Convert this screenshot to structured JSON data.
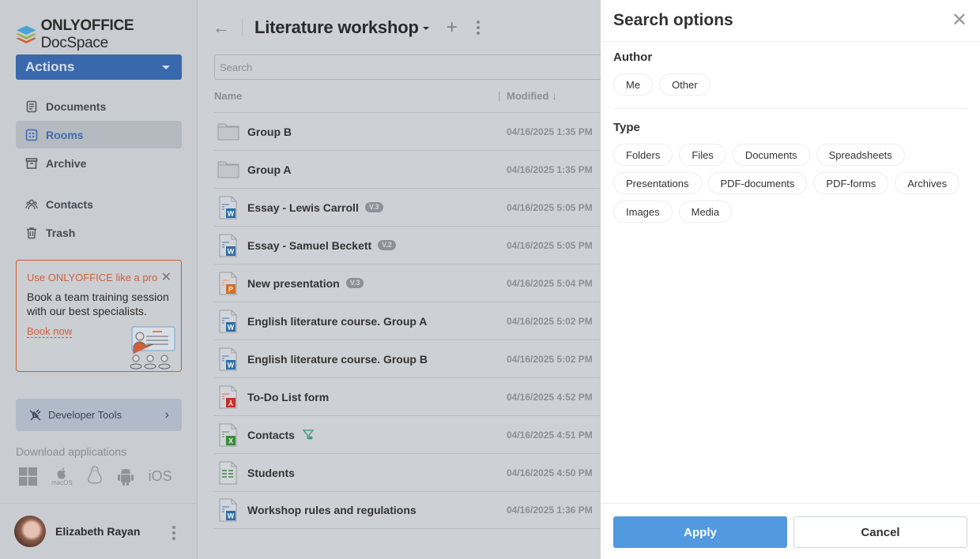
{
  "app": {
    "logo_bold": "ONLYOFFICE",
    "logo_light": "DocSpace"
  },
  "sidebar": {
    "actions_label": "Actions",
    "nav_primary": [
      {
        "label": "Documents",
        "icon": "document-icon",
        "active": false
      },
      {
        "label": "Rooms",
        "icon": "rooms-icon",
        "active": true
      },
      {
        "label": "Archive",
        "icon": "archive-icon",
        "active": false
      }
    ],
    "nav_secondary": [
      {
        "label": "Contacts",
        "icon": "contacts-icon"
      },
      {
        "label": "Trash",
        "icon": "trash-icon"
      }
    ],
    "promo": {
      "title": "Use ONLYOFFICE like a pro",
      "body": "Book a team training session with our best specialists.",
      "link": "Book now"
    },
    "developer_tools_label": "Developer Tools",
    "download_title": "Download applications",
    "download_apps": [
      "windows-icon",
      "macos-icon",
      "linux-icon",
      "android-icon",
      "ios-icon"
    ],
    "macos_label": "macOS",
    "ios_label": "iOS",
    "user_name": "Elizabeth Rayan"
  },
  "main": {
    "room_title": "Literature workshop",
    "search_placeholder": "Search",
    "columns": {
      "name": "Name",
      "modified": "Modified",
      "sort_arrow": "↓"
    },
    "files": [
      {
        "name": "Group B",
        "type": "folder",
        "badge": "",
        "modified": "04/16/2025 1:35 PM"
      },
      {
        "name": "Group A",
        "type": "folder",
        "badge": "",
        "modified": "04/16/2025 1:35 PM"
      },
      {
        "name": "Essay - Lewis Carroll",
        "type": "docx",
        "badge": "V.3",
        "modified": "04/16/2025 5:05 PM"
      },
      {
        "name": "Essay - Samuel Beckett",
        "type": "docx",
        "badge": "V.2",
        "modified": "04/16/2025 5:05 PM"
      },
      {
        "name": "New presentation",
        "type": "pptx",
        "badge": "V.3",
        "modified": "04/16/2025 5:04 PM"
      },
      {
        "name": "English literature course. Group A",
        "type": "docx",
        "badge": "",
        "modified": "04/16/2025 5:02 PM"
      },
      {
        "name": "English literature course. Group B",
        "type": "docx",
        "badge": "",
        "modified": "04/16/2025 5:02 PM"
      },
      {
        "name": "To-Do List form",
        "type": "pdf",
        "badge": "",
        "modified": "04/16/2025 4:52 PM"
      },
      {
        "name": "Contacts",
        "type": "xlsx",
        "badge": "",
        "form_filter": true,
        "modified": "04/16/2025 4:51 PM"
      },
      {
        "name": "Students",
        "type": "csv",
        "badge": "",
        "modified": "04/16/2025 4:50 PM"
      },
      {
        "name": "Workshop rules and regulations",
        "type": "docx",
        "badge": "",
        "modified": "04/16/2025 1:36 PM"
      }
    ]
  },
  "panel": {
    "title": "Search options",
    "author_label": "Author",
    "author_options": [
      "Me",
      "Other"
    ],
    "type_label": "Type",
    "type_options": [
      "Folders",
      "Files",
      "Documents",
      "Spreadsheets",
      "Presentations",
      "PDF-documents",
      "PDF-forms",
      "Archives",
      "Images",
      "Media"
    ],
    "apply_label": "Apply",
    "cancel_label": "Cancel"
  },
  "colors": {
    "accent": "#5299e0",
    "actions_button": "#3a68ad",
    "promo": "#d0603a",
    "docx": "#2c6ea6",
    "xlsx": "#3a8a3a",
    "pptx": "#d36b2a",
    "pdf": "#c8302a"
  }
}
